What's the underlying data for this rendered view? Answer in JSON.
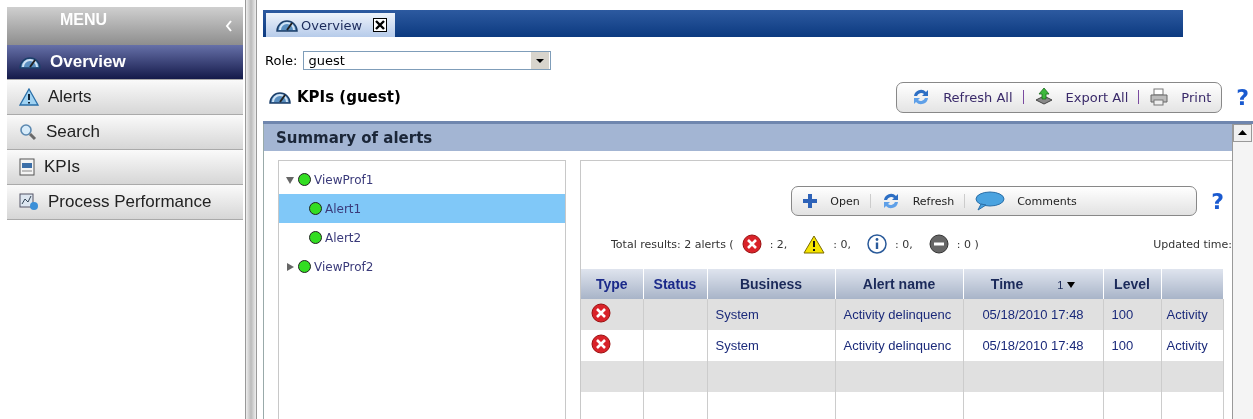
{
  "menu": {
    "title": "MENU",
    "items": [
      {
        "label": "Overview",
        "kind": "gauge",
        "selected": true
      },
      {
        "label": "Alerts",
        "kind": "warning",
        "selected": false
      },
      {
        "label": "Search",
        "kind": "search",
        "selected": false
      },
      {
        "label": "KPIs",
        "kind": "kpi",
        "selected": false
      },
      {
        "label": "Process Performance",
        "kind": "process",
        "selected": false
      }
    ]
  },
  "tabs": [
    {
      "label": "Overview",
      "selected": true
    }
  ],
  "role": {
    "label": "Role:",
    "value": "guest"
  },
  "page_title": "KPIs (guest)",
  "toolbar": [
    {
      "label": "Refresh All",
      "kind": "refresh"
    },
    {
      "label": "Export All",
      "kind": "export"
    },
    {
      "label": "Print",
      "kind": "print"
    }
  ],
  "help": "?",
  "panel": {
    "title": "Summary of alerts",
    "tree": [
      {
        "label": "ViewProf1",
        "color": "#33dd22",
        "expanded": true,
        "selected": false,
        "children": [
          {
            "label": "Alert1",
            "color": "#33dd22",
            "selected": true
          },
          {
            "label": "Alert2",
            "color": "#33dd22",
            "selected": false
          }
        ]
      },
      {
        "label": "ViewProf2",
        "color": "#33dd22",
        "expanded": false,
        "selected": false
      }
    ],
    "actions": [
      {
        "label": "Open",
        "kind": "plus"
      },
      {
        "label": "Refresh",
        "kind": "refresh"
      },
      {
        "label": "Comments",
        "kind": "comment"
      }
    ],
    "help": "?",
    "summary": {
      "label": "Total results: 2 alerts (",
      "counts": [
        {
          "kind": "error",
          "text": ": 2,"
        },
        {
          "kind": "warning",
          "text": ": 0,"
        },
        {
          "kind": "info",
          "text": ": 0,"
        },
        {
          "kind": "blocked",
          "text": ": 0 )"
        }
      ],
      "updated": "Updated time:"
    },
    "table": {
      "columns": [
        {
          "label": "Type"
        },
        {
          "label": "Status"
        },
        {
          "label": "Business"
        },
        {
          "label": "Alert name"
        },
        {
          "label": "Time",
          "sort": "1"
        },
        {
          "label": "Level"
        },
        {}
      ],
      "rows": [
        {
          "kind": "error",
          "business": "System",
          "alert_name": "Activity delinquenc",
          "time": "05/18/2010 17:48",
          "level": "100",
          "column_7": "Activity"
        },
        {
          "kind": "error",
          "business": "System",
          "alert_name": "Activity delinquenc",
          "time": "05/18/2010 17:48",
          "level": "100",
          "column_7": "Activity"
        }
      ]
    }
  }
}
